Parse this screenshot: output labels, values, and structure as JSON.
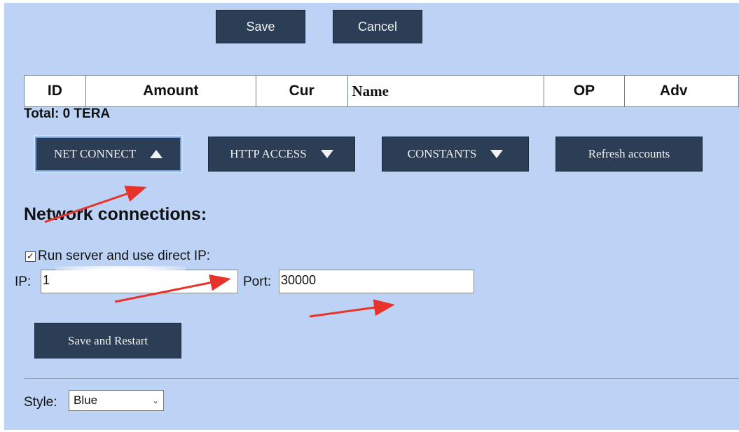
{
  "toolbar": {
    "save_label": "Save",
    "cancel_label": "Cancel"
  },
  "accounts_table": {
    "columns": [
      "ID",
      "Amount",
      "Cur",
      "Name",
      "OP",
      "Adv"
    ]
  },
  "total_label": "Total: 0 TERA",
  "tabs": [
    {
      "label": "NET CONNECT",
      "icon": "triangle-up-icon",
      "active": true
    },
    {
      "label": "HTTP ACCESS",
      "icon": "triangle-down-icon"
    },
    {
      "label": "CONSTANTS",
      "icon": "triangle-down-icon"
    },
    {
      "label": "Refresh accounts"
    }
  ],
  "network": {
    "title": "Network connections:",
    "run_server_label": "Run server and use direct IP:",
    "run_server_checked": true,
    "ip_label": "IP:",
    "ip_value": "1",
    "port_label": "Port:",
    "port_value": "30000",
    "save_restart_label": "Save and Restart"
  },
  "style": {
    "label": "Style:",
    "selected": "Blue"
  },
  "colors": {
    "background": "#bdd3f5",
    "button": "#2b3e55",
    "arrow_annotation": "#e8332a"
  }
}
